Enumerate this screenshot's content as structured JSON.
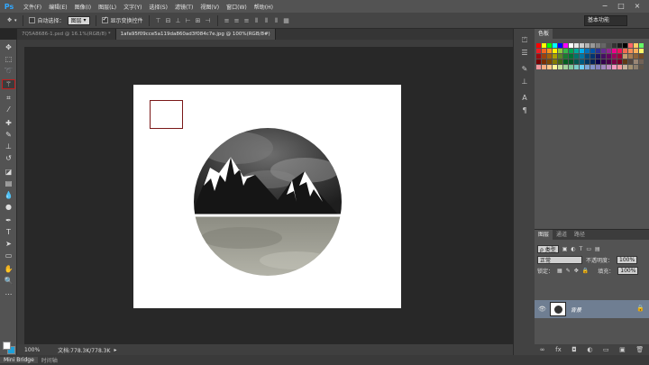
{
  "app": {
    "logo": "Ps"
  },
  "menu": [
    "文件(F)",
    "编辑(E)",
    "图像(I)",
    "图层(L)",
    "文字(Y)",
    "选择(S)",
    "滤镜(T)",
    "视图(V)",
    "窗口(W)",
    "帮助(H)"
  ],
  "window_controls": [
    "−",
    "□",
    "×"
  ],
  "options": {
    "auto_select_label": "自动选择：",
    "auto_select_target": "图层",
    "show_transform_label": "显示变换控件",
    "workspace": "基本功能"
  },
  "tabs": [
    {
      "label": "7Q5A8686-1.psd @ 16.1%(RGB/8) *",
      "active": false
    },
    {
      "label": "1afa95f09cce5a119da860ad3f084c7e.jpg @ 100%(RGB/8#)",
      "active": true
    }
  ],
  "status": {
    "zoom": "100%",
    "doc_info": "文档:778.3K/778.3K"
  },
  "bottom_tabs": [
    "Mini Bridge",
    "时间轴"
  ],
  "swatches_panel": {
    "title": "色板"
  },
  "layers_panel": {
    "tabs": [
      "图层",
      "通道",
      "路径"
    ],
    "filter_kind": "ρ 类型",
    "blend_mode": "正常",
    "opacity_label": "不透明度：",
    "opacity_value": "100%",
    "lock_label": "锁定：",
    "fill_label": "填充：",
    "fill_value": "100%",
    "layer_name": "背景"
  },
  "colors": {
    "accent": "#31a8ff",
    "selection": "#c02020",
    "layer_selected": "#6f7e92"
  }
}
